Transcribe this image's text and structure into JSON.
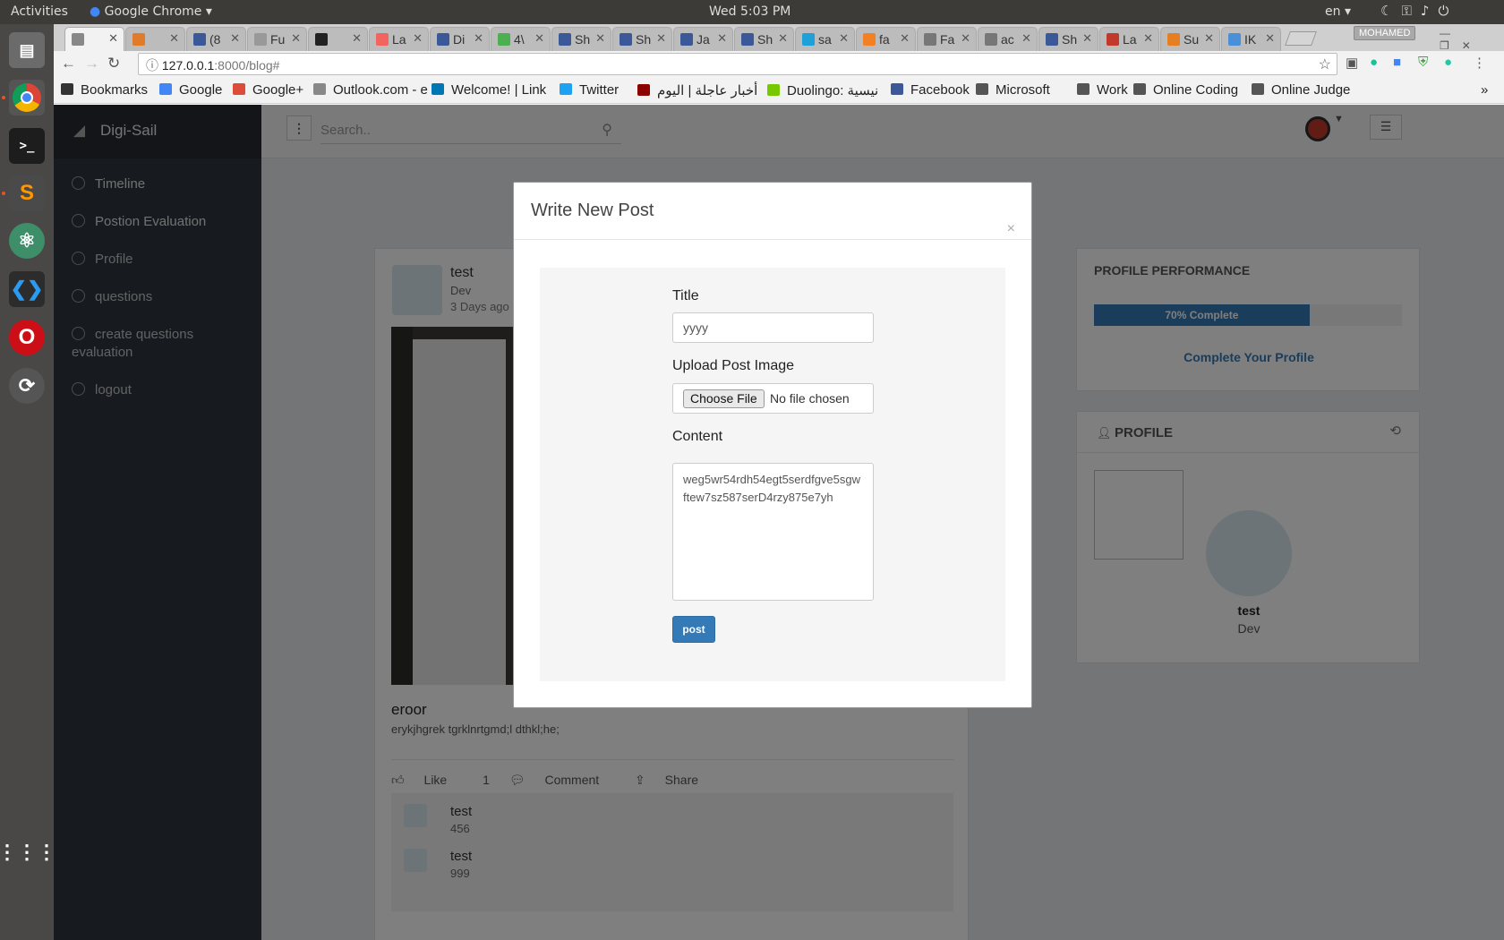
{
  "os": {
    "activities": "Activities",
    "app_name": "Google Chrome",
    "clock": "Wed  5:03 PM",
    "lang": "en"
  },
  "browser": {
    "tabs": [
      {
        "label": "",
        "color": "#888888",
        "active": true
      },
      {
        "label": "",
        "color": "#e07b2a"
      },
      {
        "label": "(8",
        "color": "#3b5998"
      },
      {
        "label": "Fu",
        "color": "#999999"
      },
      {
        "label": "",
        "color": "#222222"
      },
      {
        "label": "La",
        "color": "#f4645f"
      },
      {
        "label": "Di",
        "color": "#3b5998"
      },
      {
        "label": "4\\",
        "color": "#4caf50"
      },
      {
        "label": "Sh",
        "color": "#3b5998"
      },
      {
        "label": "Sh",
        "color": "#3b5998"
      },
      {
        "label": "Ja",
        "color": "#3b5998"
      },
      {
        "label": "Sh",
        "color": "#3b5998"
      },
      {
        "label": "sa",
        "color": "#1fa0d8"
      },
      {
        "label": "fa",
        "color": "#f48024"
      },
      {
        "label": "Fa",
        "color": "#777777"
      },
      {
        "label": "ac",
        "color": "#777777"
      },
      {
        "label": "Sh",
        "color": "#3b5998"
      },
      {
        "label": "La",
        "color": "#c0392b"
      },
      {
        "label": "Su",
        "color": "#e67e22"
      },
      {
        "label": "IK",
        "color": "#4a90d9"
      }
    ],
    "profile_name": "MOHAMED",
    "url_host": "127.0.0.1",
    "url_path": ":8000/blog#",
    "bookmarks": [
      {
        "label": "Bookmarks",
        "color": "#333333"
      },
      {
        "label": "Google",
        "color": "#4285f4"
      },
      {
        "label": "Google+",
        "color": "#dd4b39"
      },
      {
        "label": "Outlook.com - e",
        "color": "#888888"
      },
      {
        "label": "Welcome! | Link",
        "color": "#0077b5"
      },
      {
        "label": "Twitter",
        "color": "#1da1f2"
      },
      {
        "label": "أخبار عاجلة | اليوم",
        "color": "#8b0000"
      },
      {
        "label": "Duolingo: نيسية",
        "color": "#78c800"
      },
      {
        "label": "Facebook",
        "color": "#3b5998"
      },
      {
        "label": "Microsoft",
        "color": "#555555"
      },
      {
        "label": "Work",
        "color": "#555555"
      },
      {
        "label": "Online Coding",
        "color": "#555555"
      },
      {
        "label": "Online Judge",
        "color": "#555555"
      }
    ],
    "more": "»"
  },
  "app": {
    "brand": "Digi-Sail",
    "menu": [
      {
        "label": "Timeline",
        "name": "timeline"
      },
      {
        "label": "Postion Evaluation",
        "name": "position-evaluation"
      },
      {
        "label": "Profile",
        "name": "profile"
      },
      {
        "label": "questions",
        "name": "questions"
      },
      {
        "label": "create questions evaluation",
        "name": "create-questions-evaluation"
      },
      {
        "label": "logout",
        "name": "logout"
      }
    ],
    "search_placeholder": "Search.."
  },
  "post": {
    "user": "test",
    "role": "Dev",
    "time": "3 Days ago",
    "title": "eroor",
    "body": "erykjhgrek tgrklnrtgmd;l dthkl;he;",
    "like_label": "Like",
    "like_count": "1",
    "comment_label": "Comment",
    "share_label": "Share",
    "comments": [
      {
        "user": "test",
        "text": "456"
      },
      {
        "user": "test",
        "text": "999"
      }
    ]
  },
  "performance": {
    "title": "PROFILE PERFORMANCE",
    "progress_label": "70% Complete",
    "progress_percent": 70,
    "link": "Complete Your Profile"
  },
  "profile_box": {
    "title": "PROFILE",
    "name": "test",
    "role": "Dev"
  },
  "modal": {
    "title": "Write New Post",
    "close": "×",
    "title_label": "Title",
    "title_value": "yyyy",
    "image_label": "Upload Post Image",
    "choose_file": "Choose File",
    "no_file": "No file chosen",
    "content_label": "Content",
    "content_value": "weg5wr54rdh54egt5serdfgve5sgwftew7sz587serD4rzy875e7yh",
    "submit": "post"
  }
}
